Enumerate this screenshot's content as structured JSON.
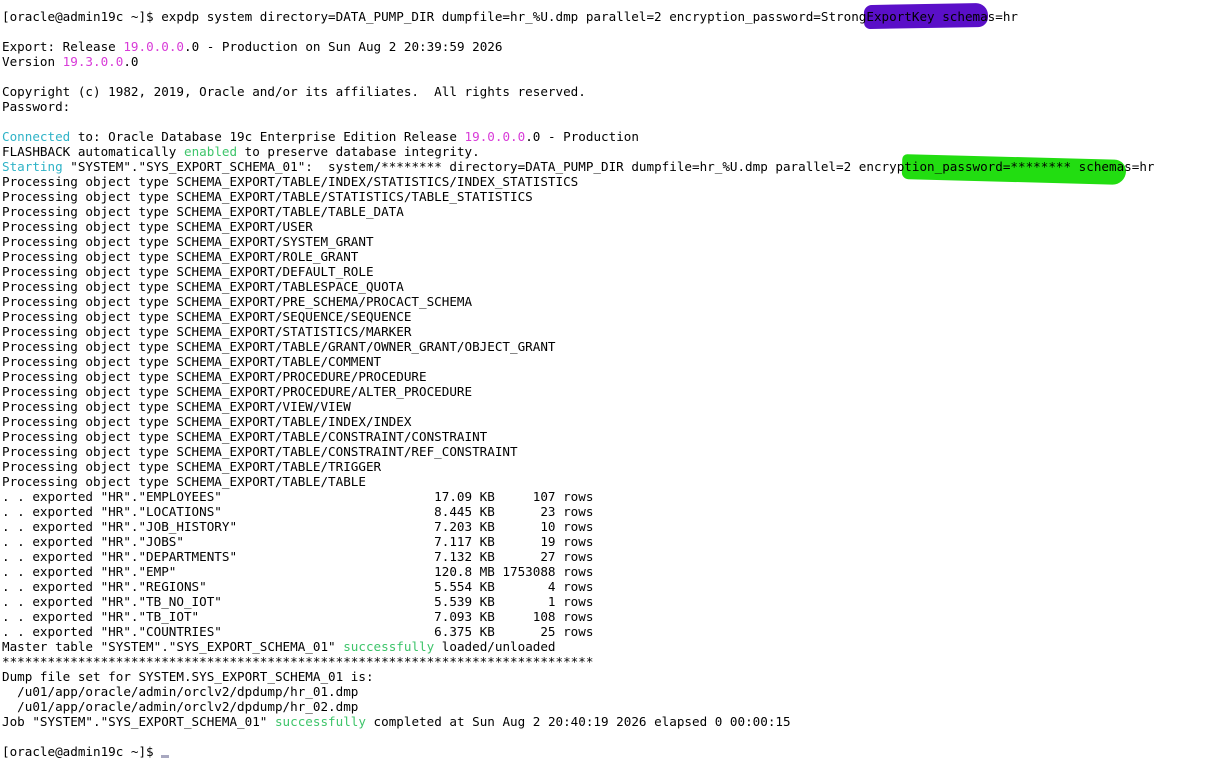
{
  "terminal": {
    "lines": [
      [
        {
          "t": "[oracle@admin19c ~]$ expdp system directory=DATA_PUMP_DIR dumpfile=hr_%U.dmp parallel=2 encryption_password="
        },
        {
          "t": "StrongExportKey"
        },
        {
          "t": " schemas=hr"
        }
      ],
      [],
      [
        {
          "t": "Export: Release "
        },
        {
          "t": "19.0.0.0",
          "c": "mag"
        },
        {
          "t": ".0 - Production on Sun Aug 2 20:39:59 2026"
        }
      ],
      [
        {
          "t": "Version "
        },
        {
          "t": "19.3.0.0",
          "c": "mag"
        },
        {
          "t": ".0"
        }
      ],
      [],
      [
        {
          "t": "Copyright (c) 1982, 2019, Oracle and/or its affiliates.  All rights reserved."
        }
      ],
      [
        {
          "t": "Password:"
        }
      ],
      [],
      [
        {
          "t": "Connected",
          "c": "cyan"
        },
        {
          "t": " to: Oracle Database 19c Enterprise Edition Release "
        },
        {
          "t": "19.0.0.0",
          "c": "mag"
        },
        {
          "t": ".0 - Production"
        }
      ],
      [
        {
          "t": "FLASHBACK automatically "
        },
        {
          "t": "enabled",
          "c": "grn"
        },
        {
          "t": " to preserve database integrity."
        }
      ],
      [
        {
          "t": "Starting",
          "c": "cyan"
        },
        {
          "t": " \"SYSTEM\".\"SYS_EXPORT_SCHEMA_01\":  system/******** directory=DATA_PUMP_DIR dumpfile=hr_%U.dmp parallel=2 encryption_password=******** schemas=hr"
        }
      ],
      [
        {
          "t": "Processing object type SCHEMA_EXPORT/TABLE/INDEX/STATISTICS/INDEX_STATISTICS"
        }
      ],
      [
        {
          "t": "Processing object type SCHEMA_EXPORT/TABLE/STATISTICS/TABLE_STATISTICS"
        }
      ],
      [
        {
          "t": "Processing object type SCHEMA_EXPORT/TABLE/TABLE_DATA"
        }
      ],
      [
        {
          "t": "Processing object type SCHEMA_EXPORT/USER"
        }
      ],
      [
        {
          "t": "Processing object type SCHEMA_EXPORT/SYSTEM_GRANT"
        }
      ],
      [
        {
          "t": "Processing object type SCHEMA_EXPORT/ROLE_GRANT"
        }
      ],
      [
        {
          "t": "Processing object type SCHEMA_EXPORT/DEFAULT_ROLE"
        }
      ],
      [
        {
          "t": "Processing object type SCHEMA_EXPORT/TABLESPACE_QUOTA"
        }
      ],
      [
        {
          "t": "Processing object type SCHEMA_EXPORT/PRE_SCHEMA/PROCACT_SCHEMA"
        }
      ],
      [
        {
          "t": "Processing object type SCHEMA_EXPORT/SEQUENCE/SEQUENCE"
        }
      ],
      [
        {
          "t": "Processing object type SCHEMA_EXPORT/STATISTICS/MARKER"
        }
      ],
      [
        {
          "t": "Processing object type SCHEMA_EXPORT/TABLE/GRANT/OWNER_GRANT/OBJECT_GRANT"
        }
      ],
      [
        {
          "t": "Processing object type SCHEMA_EXPORT/TABLE/COMMENT"
        }
      ],
      [
        {
          "t": "Processing object type SCHEMA_EXPORT/PROCEDURE/PROCEDURE"
        }
      ],
      [
        {
          "t": "Processing object type SCHEMA_EXPORT/PROCEDURE/ALTER_PROCEDURE"
        }
      ],
      [
        {
          "t": "Processing object type SCHEMA_EXPORT/VIEW/VIEW"
        }
      ],
      [
        {
          "t": "Processing object type SCHEMA_EXPORT/TABLE/INDEX/INDEX"
        }
      ],
      [
        {
          "t": "Processing object type SCHEMA_EXPORT/TABLE/CONSTRAINT/CONSTRAINT"
        }
      ],
      [
        {
          "t": "Processing object type SCHEMA_EXPORT/TABLE/CONSTRAINT/REF_CONSTRAINT"
        }
      ],
      [
        {
          "t": "Processing object type SCHEMA_EXPORT/TABLE/TRIGGER"
        }
      ],
      [
        {
          "t": "Processing object type SCHEMA_EXPORT/TABLE/TABLE"
        }
      ],
      [
        {
          "t": ". . exported \"HR\".\"EMPLOYEES\"                            17.09 KB     107 rows"
        }
      ],
      [
        {
          "t": ". . exported \"HR\".\"LOCATIONS\"                            8.445 KB      23 rows"
        }
      ],
      [
        {
          "t": ". . exported \"HR\".\"JOB_HISTORY\"                          7.203 KB      10 rows"
        }
      ],
      [
        {
          "t": ". . exported \"HR\".\"JOBS\"                                 7.117 KB      19 rows"
        }
      ],
      [
        {
          "t": ". . exported \"HR\".\"DEPARTMENTS\"                          7.132 KB      27 rows"
        }
      ],
      [
        {
          "t": ". . exported \"HR\".\"EMP\"                                  120.8 MB 1753088 rows"
        }
      ],
      [
        {
          "t": ". . exported \"HR\".\"REGIONS\"                              5.554 KB       4 rows"
        }
      ],
      [
        {
          "t": ". . exported \"HR\".\"TB_NO_IOT\"                            5.539 KB       1 rows"
        }
      ],
      [
        {
          "t": ". . exported \"HR\".\"TB_IOT\"                               7.093 KB     108 rows"
        }
      ],
      [
        {
          "t": ". . exported \"HR\".\"COUNTRIES\"                            6.375 KB      25 rows"
        }
      ],
      [
        {
          "t": "Master table \"SYSTEM\".\"SYS_EXPORT_SCHEMA_01\" "
        },
        {
          "t": "successfully",
          "c": "grn"
        },
        {
          "t": " loaded/unloaded"
        }
      ],
      [
        {
          "t": "******************************************************************************"
        }
      ],
      [
        {
          "t": "Dump file set for SYSTEM.SYS_EXPORT_SCHEMA_01 is:"
        }
      ],
      [
        {
          "t": "  /u01/app/oracle/admin/orclv2/dpdump/hr_01.dmp"
        }
      ],
      [
        {
          "t": "  /u01/app/oracle/admin/orclv2/dpdump/hr_02.dmp"
        }
      ],
      [
        {
          "t": "Job \"SYSTEM\".\"SYS_EXPORT_SCHEMA_01\" "
        },
        {
          "t": "successfully",
          "c": "grn"
        },
        {
          "t": " completed at Sun Aug 2 20:40:19 2026 elapsed 0 00:00:15"
        }
      ],
      [],
      [
        {
          "t": "[oracle@admin19c ~]$ "
        }
      ]
    ]
  },
  "colors": {
    "background": "#ffffff",
    "text": "#000000",
    "magenta": "#d83bd8",
    "cyan": "#2fb3c7",
    "green": "#3ec46a",
    "redaction": "#5a0fc8",
    "highlighter": "#22dd11"
  }
}
